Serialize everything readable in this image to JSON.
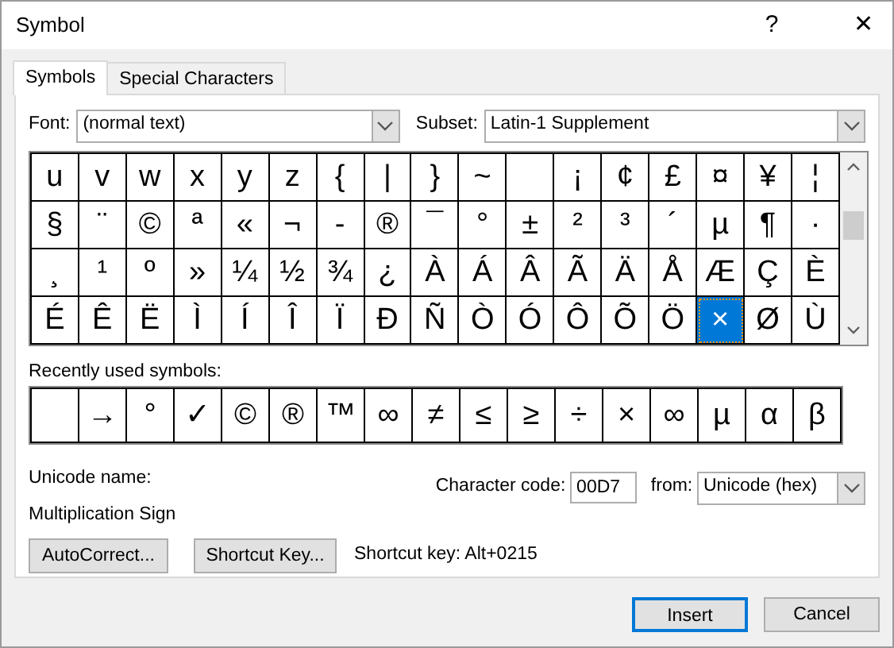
{
  "window": {
    "title": "Symbol",
    "help": "?",
    "close": "✕"
  },
  "tabs": [
    {
      "label": "Symbols",
      "selected": true
    },
    {
      "label": "Special Characters",
      "selected": false
    }
  ],
  "font": {
    "label": "Font:",
    "value": "(normal text)"
  },
  "subset": {
    "label": "Subset:",
    "value": "Latin-1 Supplement"
  },
  "grid": [
    [
      {
        "ch": "u",
        "selected": false
      },
      {
        "ch": "v",
        "selected": false
      },
      {
        "ch": "w",
        "selected": false
      },
      {
        "ch": "x",
        "selected": false
      },
      {
        "ch": "y",
        "selected": false
      },
      {
        "ch": "z",
        "selected": false
      },
      {
        "ch": "{",
        "selected": false
      },
      {
        "ch": "|",
        "selected": false
      },
      {
        "ch": "}",
        "selected": false
      },
      {
        "ch": "~",
        "selected": false
      },
      {
        "kind": "blank",
        "selected": false
      },
      {
        "ch": "¡",
        "selected": false
      },
      {
        "ch": "¢",
        "selected": false
      },
      {
        "ch": "£",
        "selected": false
      },
      {
        "ch": "¤",
        "selected": false
      },
      {
        "ch": "¥",
        "selected": false
      },
      {
        "ch": "¦",
        "selected": false
      }
    ],
    [
      {
        "ch": "§",
        "selected": false
      },
      {
        "ch": "¨",
        "selected": false
      },
      {
        "ch": "©",
        "selected": false
      },
      {
        "ch": "ª",
        "selected": false
      },
      {
        "ch": "«",
        "selected": false
      },
      {
        "ch": "¬",
        "selected": false
      },
      {
        "ch": "-",
        "selected": false
      },
      {
        "ch": "®",
        "selected": false
      },
      {
        "ch": "¯",
        "selected": false
      },
      {
        "ch": "°",
        "selected": false
      },
      {
        "ch": "±",
        "selected": false
      },
      {
        "ch": "²",
        "selected": false
      },
      {
        "ch": "³",
        "selected": false
      },
      {
        "ch": "´",
        "selected": false
      },
      {
        "ch": "µ",
        "selected": false
      },
      {
        "ch": "¶",
        "selected": false
      },
      {
        "ch": "·",
        "selected": false
      }
    ],
    [
      {
        "ch": "¸",
        "selected": false
      },
      {
        "ch": "¹",
        "selected": false
      },
      {
        "ch": "º",
        "selected": false
      },
      {
        "ch": "»",
        "selected": false
      },
      {
        "ch": "¼",
        "selected": false
      },
      {
        "ch": "½",
        "selected": false
      },
      {
        "ch": "¾",
        "selected": false
      },
      {
        "ch": "¿",
        "selected": false
      },
      {
        "ch": "À",
        "selected": false
      },
      {
        "ch": "Á",
        "selected": false
      },
      {
        "ch": "Â",
        "selected": false
      },
      {
        "ch": "Ã",
        "selected": false
      },
      {
        "ch": "Ä",
        "selected": false
      },
      {
        "ch": "Å",
        "selected": false
      },
      {
        "ch": "Æ",
        "selected": false
      },
      {
        "ch": "Ç",
        "selected": false
      },
      {
        "ch": "È",
        "selected": false
      }
    ],
    [
      {
        "ch": "É",
        "selected": false
      },
      {
        "ch": "Ê",
        "selected": false
      },
      {
        "ch": "Ë",
        "selected": false
      },
      {
        "ch": "Ì",
        "selected": false
      },
      {
        "ch": "Í",
        "selected": false
      },
      {
        "ch": "Î",
        "selected": false
      },
      {
        "ch": "Ï",
        "selected": false
      },
      {
        "ch": "Ð",
        "selected": false
      },
      {
        "ch": "Ñ",
        "selected": false
      },
      {
        "ch": "Ò",
        "selected": false
      },
      {
        "ch": "Ó",
        "selected": false
      },
      {
        "ch": "Ô",
        "selected": false
      },
      {
        "ch": "Õ",
        "selected": false
      },
      {
        "ch": "Ö",
        "selected": false
      },
      {
        "ch": "×",
        "selected": true
      },
      {
        "ch": "Ø",
        "selected": false
      },
      {
        "ch": "Ù",
        "selected": false
      }
    ]
  ],
  "recent": {
    "label": "Recently used symbols:",
    "items": [
      {
        "kind": "blank"
      },
      {
        "ch": "→"
      },
      {
        "ch": "°"
      },
      {
        "ch": "✓"
      },
      {
        "ch": "©"
      },
      {
        "ch": "®"
      },
      {
        "ch": "™"
      },
      {
        "ch": "∞"
      },
      {
        "ch": "≠"
      },
      {
        "ch": "≤"
      },
      {
        "ch": "≥"
      },
      {
        "ch": "÷"
      },
      {
        "ch": "×"
      },
      {
        "ch": "∞"
      },
      {
        "ch": "µ"
      },
      {
        "ch": "α"
      },
      {
        "ch": "β"
      }
    ]
  },
  "unicode_name": {
    "label": "Unicode name:",
    "value": "Multiplication Sign"
  },
  "character_code": {
    "label": "Character code:",
    "value": "00D7"
  },
  "from": {
    "label": "from:",
    "value": "Unicode (hex)"
  },
  "buttons": [
    "AutoCorrect...",
    "Shortcut Key..."
  ],
  "shortcut_key": "Shortcut key: Alt+0215",
  "footer_buttons": [
    {
      "label": "Insert",
      "default": true
    },
    {
      "label": "Cancel",
      "default": false
    }
  ]
}
